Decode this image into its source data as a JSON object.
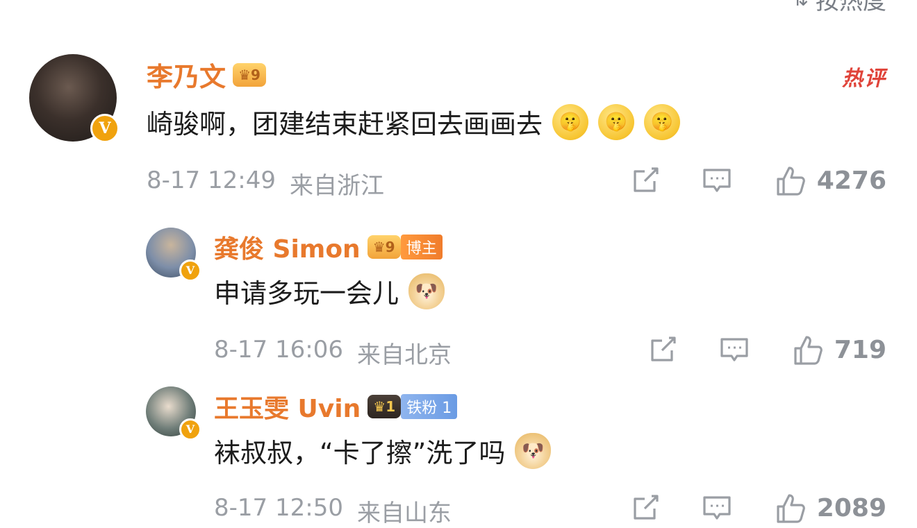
{
  "sort_label": "按热度",
  "comments": [
    {
      "name": "李乃文",
      "badge_icon": "crown-level-9-icon",
      "hot_label": "热评",
      "text": "崎骏啊，团建结束赶紧回去画画去",
      "emojis": [
        "shush",
        "shush",
        "shush"
      ],
      "date": "8-17 12:49",
      "location": "来自浙江",
      "likes": "4276"
    },
    {
      "name": "龚俊 Simon",
      "badge_icon": "crown-level-9-icon",
      "tag": "博主",
      "text": "申请多玩一会儿",
      "emojis": [
        "doge"
      ],
      "date": "8-17 16:06",
      "location": "来自北京",
      "likes": "719"
    },
    {
      "name": "王玉雯 Uvin",
      "badge_icon": "crown-level-1-icon",
      "tag": "铁粉 1",
      "text": "袜叔叔，“卡了擦”洗了吗",
      "emojis": [
        "doge"
      ],
      "date": "8-17 12:50",
      "location": "来自山东",
      "likes": "2089"
    }
  ],
  "colors": {
    "name": "#e8792d",
    "meta": "#9a9ea4",
    "hot": "#e0443a",
    "verified": "#f0a20e"
  }
}
